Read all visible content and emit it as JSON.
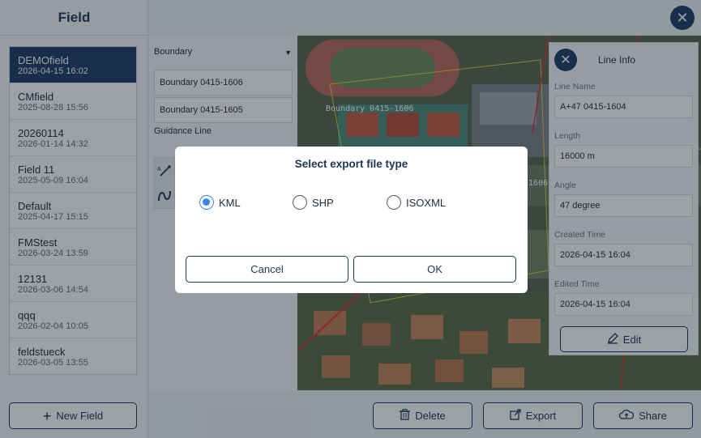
{
  "sidebar": {
    "title": "Field",
    "fields": [
      {
        "name": "DEMOfield",
        "date": "2026-04-15 16:02",
        "selected": true
      },
      {
        "name": "CMfield",
        "date": "2025-08-28 15:56"
      },
      {
        "name": "20260114",
        "date": "2026-01-14 14:32"
      },
      {
        "name": "Field 11",
        "date": "2025-05-09 16:04"
      },
      {
        "name": "Default",
        "date": "2025-04-17 15:15"
      },
      {
        "name": "FMStest",
        "date": "2026-03-24 13:59"
      },
      {
        "name": "12131",
        "date": "2026-03-06 14:54"
      },
      {
        "name": "qqq",
        "date": "2026-02-04 10:05"
      },
      {
        "name": "feldstueck",
        "date": "2026-03-05 13:55"
      }
    ],
    "new_field_label": "New Field"
  },
  "mid": {
    "boundary_select": "Boundary",
    "boundaries": [
      "Boundary 0415-1606",
      "Boundary 0415-1605"
    ],
    "guidance_label": "Guidance Line"
  },
  "map": {
    "label_boundary": "Boundary 0415-1606",
    "label_partial": "1606"
  },
  "info": {
    "title": "Line Info",
    "line_name_label": "Line Name",
    "line_name": "A+47 0415-1604",
    "length_label": "Length",
    "length": "16000 m",
    "angle_label": "Angle",
    "angle": "47 degree",
    "created_label": "Created Time",
    "created": "2026-04-15 16:04",
    "edited_label": "Edited Time",
    "edited": "2026-04-15 16:04",
    "edit_label": "Edit"
  },
  "bottom": {
    "delete_label": "Delete",
    "export_label": "Export",
    "share_label": "Share"
  },
  "dialog": {
    "title": "Select export file type",
    "options": [
      "KML",
      "SHP",
      "ISOXML"
    ],
    "selected": "KML",
    "cancel_label": "Cancel",
    "ok_label": "OK"
  },
  "colors": {
    "accent": "#1d3a64",
    "radio_selected": "#3b82f6"
  }
}
